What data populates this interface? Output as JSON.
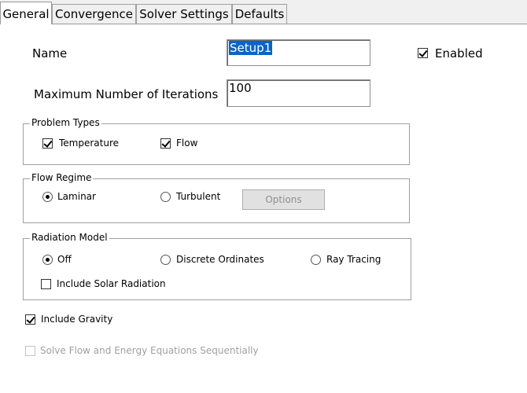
{
  "tabs": [
    {
      "label": "General",
      "active": true
    },
    {
      "label": "Convergence",
      "active": false
    },
    {
      "label": "Solver Settings",
      "active": false
    },
    {
      "label": "Defaults",
      "active": false
    }
  ],
  "general": {
    "name_label": "Name",
    "name_value": "Setup1",
    "enabled_label": "Enabled",
    "enabled_checked": true,
    "max_iter_label": "Maximum Number of Iterations",
    "max_iter_value": "100"
  },
  "problem_types": {
    "title": "Problem Types",
    "temperature_label": "Temperature",
    "temperature_checked": true,
    "flow_label": "Flow",
    "flow_checked": true
  },
  "flow_regime": {
    "title": "Flow Regime",
    "laminar_label": "Laminar",
    "turbulent_label": "Turbulent",
    "selected": "Laminar",
    "options_button": "Options"
  },
  "radiation_model": {
    "title": "Radiation Model",
    "off_label": "Off",
    "discrete_label": "Discrete Ordinates",
    "ray_label": "Ray Tracing",
    "selected": "Off",
    "solar_label": "Include Solar Radiation",
    "solar_checked": false
  },
  "include_gravity": {
    "label": "Include Gravity",
    "checked": true
  },
  "sequential": {
    "label": "Solve Flow and Energy Equations Sequentially",
    "checked": false,
    "disabled": true
  }
}
